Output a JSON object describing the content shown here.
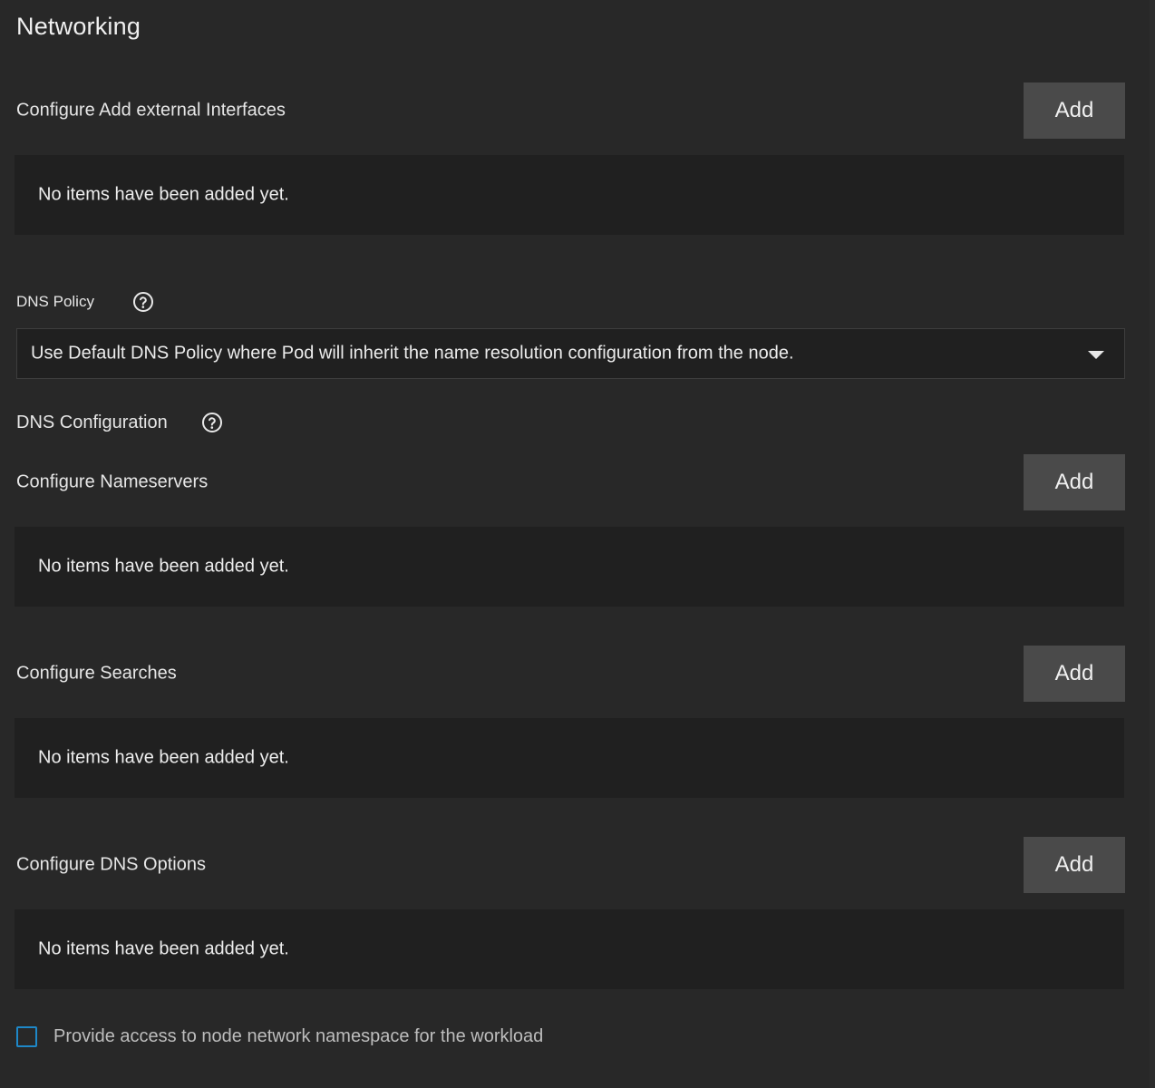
{
  "section": {
    "title": "Networking"
  },
  "external_interfaces": {
    "label": "Configure Add external Interfaces",
    "add_label": "Add",
    "empty_text": "No items have been added yet."
  },
  "dns_policy": {
    "label": "DNS Policy",
    "help_icon": "help-circle-icon",
    "selected_value": "Use Default DNS Policy where Pod will inherit the name resolution configuration from the node."
  },
  "dns_configuration": {
    "label": "DNS Configuration",
    "help_icon": "help-circle-icon"
  },
  "nameservers": {
    "label": "Configure Nameservers",
    "add_label": "Add",
    "empty_text": "No items have been added yet."
  },
  "searches": {
    "label": "Configure Searches",
    "add_label": "Add",
    "empty_text": "No items have been added yet."
  },
  "dns_options": {
    "label": "Configure DNS Options",
    "add_label": "Add",
    "empty_text": "No items have been added yet."
  },
  "host_network": {
    "label": "Provide access to node network namespace for the workload",
    "checked": false
  },
  "colors": {
    "background": "#282828",
    "panel": "#202020",
    "button": "#4a4a4a",
    "checkbox_border": "#1e88c8"
  }
}
